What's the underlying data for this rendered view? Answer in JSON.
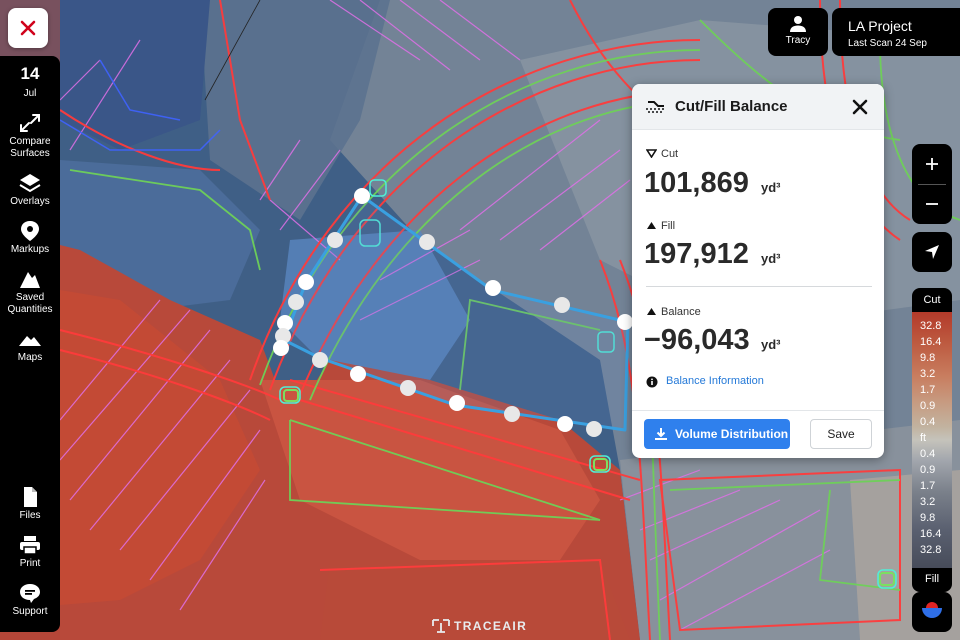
{
  "app": {
    "brand": "TRACEAIR"
  },
  "sidebar": {
    "date_day": "14",
    "date_month": "Jul",
    "items": [
      {
        "label_line1": "Compare",
        "label_line2": "Surfaces",
        "icon": "compare-arrows-icon"
      },
      {
        "label_line1": "Overlays",
        "label_line2": "",
        "icon": "layers-icon"
      },
      {
        "label_line1": "Markups",
        "label_line2": "",
        "icon": "map-pin-icon"
      },
      {
        "label_line1": "Saved",
        "label_line2": "Quantities",
        "icon": "pile-icon"
      },
      {
        "label_line1": "Maps",
        "label_line2": "",
        "icon": "mountain-icon"
      }
    ],
    "bottom_items": [
      {
        "label": "Files",
        "icon": "file-icon"
      },
      {
        "label": "Print",
        "icon": "printer-icon"
      },
      {
        "label": "Support",
        "icon": "chat-icon"
      }
    ]
  },
  "user": {
    "name": "Tracy"
  },
  "project": {
    "name": "LA Project",
    "last_scan": "Last Scan 24 Sep"
  },
  "panel": {
    "title": "Cut/Fill Balance",
    "cut_label": "Cut",
    "cut_value": "101,869",
    "fill_label": "Fill",
    "fill_value": "197,912",
    "balance_label": "Balance",
    "balance_value": "−96,043",
    "unit": "yd³",
    "info_link": "Balance Information",
    "primary_button": "Volume Distribution",
    "secondary_button": "Save"
  },
  "legend": {
    "top_label": "Cut",
    "bottom_label": "Fill",
    "values": [
      "32.8",
      "16.4",
      "9.8",
      "3.2",
      "1.7",
      "0.9",
      "0.4",
      "ft",
      "0.4",
      "0.9",
      "1.7",
      "3.2",
      "9.8",
      "16.4",
      "32.8"
    ],
    "cut_color": "#b33a2a",
    "fill_color": "#474c5a"
  },
  "colors": {
    "accent": "#2f80ed",
    "boundary": "#3aa0e0",
    "handle": "#ffffff"
  }
}
